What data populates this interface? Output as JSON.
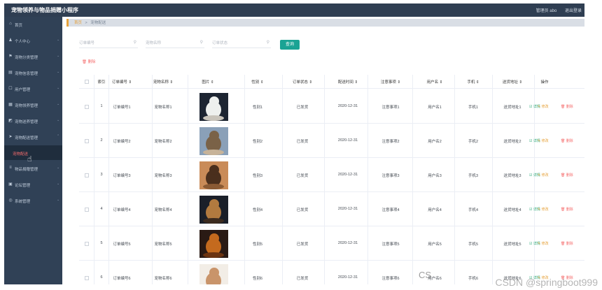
{
  "header": {
    "app_title": "宠物领养与物品捐赠小程序",
    "user_label": "管理员 abo",
    "logout_label": "退出登录"
  },
  "sidebar": {
    "items": [
      {
        "label": "首页",
        "icon": "home-icon",
        "glyph": "⌂",
        "chev": ""
      },
      {
        "label": "个人中心",
        "icon": "user-icon",
        "glyph": "♟",
        "chev": "⌄"
      },
      {
        "label": "宠物分类管理",
        "icon": "flag-icon",
        "glyph": "⚑",
        "chev": "⌄"
      },
      {
        "label": "宠物信息管理",
        "icon": "card-icon",
        "glyph": "▤",
        "chev": "⌄"
      },
      {
        "label": "用户管理",
        "icon": "user-outline-icon",
        "glyph": "☐",
        "chev": "⌄"
      },
      {
        "label": "宠物领养管理",
        "icon": "grid-icon",
        "glyph": "▦",
        "chev": "⌄"
      },
      {
        "label": "宠物送养管理",
        "icon": "chart-icon",
        "glyph": "◩",
        "chev": "⌄"
      },
      {
        "label": "宠物配送管理",
        "icon": "send-icon",
        "glyph": "➤",
        "chev": "⌃"
      },
      {
        "label": "物品捐赠管理",
        "icon": "list-icon",
        "glyph": "≡",
        "chev": "⌄"
      },
      {
        "label": "论坛管理",
        "icon": "forum-icon",
        "glyph": "▣",
        "chev": "⌄"
      },
      {
        "label": "系统管理",
        "icon": "settings-icon",
        "glyph": "◎",
        "chev": "⌄"
      }
    ],
    "active_sub_label": "宠物配送"
  },
  "breadcrumb": {
    "home": "首页",
    "sep": ">",
    "current": "宠物配送"
  },
  "search": {
    "field1_placeholder": "订单编号",
    "field2_placeholder": "宠物名称",
    "field3_placeholder": "订单状态",
    "query_label": "查询"
  },
  "delete_label": "删除",
  "table": {
    "headers": [
      "索引",
      "订单编号 ⇕",
      "宠物名称 ⇕",
      "图片 ⇕",
      "性别 ⇕",
      "订单状态 ⇕",
      "配送时间 ⇕",
      "注意事项 ⇕",
      "用户名 ⇕",
      "手机 ⇕",
      "送货地址 ⇕",
      "操作"
    ],
    "actions": {
      "detail": "详情",
      "edit": "修改",
      "delete": "删除"
    },
    "rows": [
      {
        "index": "1",
        "order_no": "订单编号1",
        "pet_name": "宠物名称1",
        "image": "white-cat",
        "gender": "性别1",
        "status": "已发货",
        "time": "2020-12-31",
        "notes": "注意事项1",
        "username": "用户名1",
        "phone": "手机1",
        "address": "送货地址1"
      },
      {
        "index": "2",
        "order_no": "订单编号2",
        "pet_name": "宠物名称2",
        "image": "running-dog",
        "gender": "性别2",
        "status": "已发货",
        "time": "2020-12-31",
        "notes": "注意事项2",
        "username": "用户名2",
        "phone": "手机2",
        "address": "送货地址2"
      },
      {
        "index": "3",
        "order_no": "订单编号3",
        "pet_name": "宠物名称3",
        "image": "brown-dog",
        "gender": "性别3",
        "status": "已发货",
        "time": "2020-12-31",
        "notes": "注意事项3",
        "username": "用户名3",
        "phone": "手机3",
        "address": "送货地址3"
      },
      {
        "index": "4",
        "order_no": "订单编号4",
        "pet_name": "宠物名称4",
        "image": "lying-dog",
        "gender": "性别4",
        "status": "已发货",
        "time": "2020-12-31",
        "notes": "注意事项4",
        "username": "用户名4",
        "phone": "手机4",
        "address": "送货地址4"
      },
      {
        "index": "5",
        "order_no": "订单编号5",
        "pet_name": "宠物名称5",
        "image": "orange-dog",
        "gender": "性别5",
        "status": "已发货",
        "time": "2020-12-31",
        "notes": "注意事项5",
        "username": "用户名5",
        "phone": "手机5",
        "address": "送货地址5"
      },
      {
        "index": "6",
        "order_no": "订单编号6",
        "pet_name": "宠物名称6",
        "image": "poodle",
        "gender": "性别6",
        "status": "已发货",
        "time": "2020-12-31",
        "notes": "注意事项6",
        "username": "用户名6",
        "phone": "手机6",
        "address": "送货地址6"
      }
    ]
  },
  "watermark": "CSDN @springboot999",
  "watermark_prefix": "CS",
  "colors": {
    "topbar": "#2f3e52",
    "sidebar": "#304156",
    "accent": "#1aa394",
    "danger": "#f56c6c",
    "warning": "#e6a23c"
  }
}
